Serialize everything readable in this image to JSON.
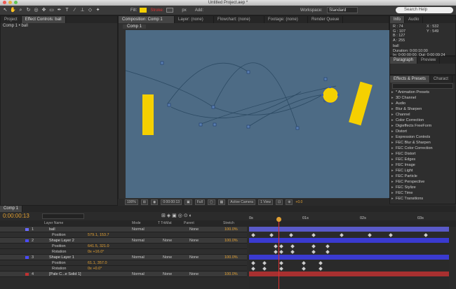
{
  "window": {
    "title": "Untitled Project.aep *"
  },
  "toolbar": {
    "fill_label": "Fill:",
    "stroke_label": "Stroke:",
    "px_label": "px",
    "add_label": "Add:",
    "workspace_label": "Workspace:",
    "workspace_value": "Standard",
    "search_placeholder": "Search Help",
    "fill_color": "#f5d000",
    "stroke_color": "#e03030"
  },
  "project": {
    "tab": "Project",
    "effect_tab": "Effect Controls: ball",
    "subtitle": "Comp 1 • ball"
  },
  "composition": {
    "tab": "Composition: Comp 1",
    "comp_tab": "Comp 1",
    "layer_tab": "Layer: (none)",
    "flowchart_tab": "Flowchart: (none)",
    "footage_tab": "Footage: (none)",
    "render_tab": "Render Queue"
  },
  "viewer": {
    "zoom": "100%",
    "time": "0:00:00:13",
    "quality": "Full",
    "camera": "Active Camera",
    "views": "1 View",
    "offset": "+0.0"
  },
  "info": {
    "tab": "Info",
    "audio_tab": "Audio",
    "r": "R : 74",
    "g": "G : 107",
    "b": "B : 127",
    "a": "A : 255",
    "x": "X : 532",
    "y": "Y : 549",
    "layer": "ball",
    "duration": "Duration: 0:00:10:00",
    "in": "In: 0:00:00:00, Out: 0:00:09:24"
  },
  "paragraph": {
    "tab": "Paragraph",
    "preview_tab": "Preview"
  },
  "effects": {
    "tab": "Effects & Presets",
    "character_tab": "Charact",
    "items": [
      "* Animation Presets",
      "3D Channel",
      "Audio",
      "Blur & Sharpen",
      "Channel",
      "Color Correction",
      "Digieffects FreeForm",
      "Distort",
      "Expression Controls",
      "FEC Blur & Sharpen",
      "FEC Color Correction",
      "FEC Distort",
      "FEC Edges",
      "FEC Image",
      "FEC Light",
      "FEC Particle",
      "FEC Perspective",
      "FEC Stylize",
      "FEC Time",
      "FEC Transitions"
    ]
  },
  "timeline": {
    "tab": "Comp 1",
    "current_time": "0:00:00:13",
    "col_layer_name": "Layer Name",
    "col_mode": "Mode",
    "col_trkmat": "T TrkMat",
    "col_parent": "Parent",
    "col_stretch": "Stretch",
    "ruler": [
      "0s",
      "01s",
      "02s",
      "03s"
    ]
  },
  "layers": [
    {
      "num": "1",
      "name": "ball",
      "mode": "Normal",
      "trkmat": "",
      "parent": "None",
      "stretch": "100.0%",
      "color": "#6a6aff"
    },
    {
      "prop": "Position",
      "value": "579.1, 153.7"
    },
    {
      "num": "2",
      "name": "Shape Layer 2",
      "mode": "Normal",
      "trkmat": "None",
      "parent": "None",
      "stretch": "100.0%",
      "color": "#4a4aff"
    },
    {
      "prop": "Position",
      "value": "641.5, 321.0"
    },
    {
      "prop": "Rotation",
      "value": "0x +16.0°"
    },
    {
      "num": "3",
      "name": "Shape Layer 1",
      "mode": "Normal",
      "trkmat": "None",
      "parent": "None",
      "stretch": "100.0%",
      "color": "#4a4aff"
    },
    {
      "prop": "Position",
      "value": "61.1, 357.0"
    },
    {
      "prop": "Rotation",
      "value": "0x +0.0°"
    },
    {
      "num": "4",
      "name": "[Pale C...e Solid 1]",
      "mode": "Normal",
      "trkmat": "None",
      "parent": "None",
      "stretch": "100.0%",
      "color": "#c03030"
    }
  ]
}
